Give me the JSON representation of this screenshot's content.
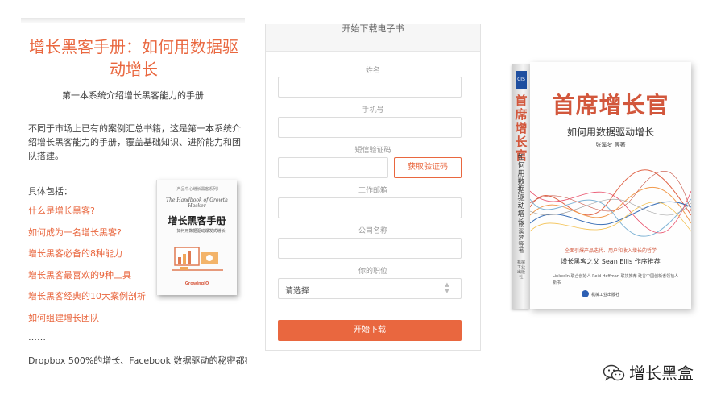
{
  "left": {
    "title": "增长黑客手册：如何用数据驱动增长",
    "subtitle": "第一本系统介绍增长黑客能力的手册",
    "intro": "不同于市场上已有的案例汇总书籍，这是第一本系统介绍增长黑客能力的手册，覆盖基础知识、进阶能力和团队搭建。",
    "includes_label": "具体包括：",
    "topics": [
      "什么是增长黑客?",
      "如何成为一名增长黑客?",
      "增长黑客必备的8种能力",
      "增长黑客最喜欢的9种工具",
      "增长黑客经典的10大案例剖析",
      "如何组建增长团队"
    ],
    "ellipsis": "……",
    "closing": "Dropbox 500%的增长、Facebook 数据驱动的秘密都在",
    "small_book": {
      "top_text": "（产品中心增长黑客系列）",
      "english_title": "The Handbook of Growth Hacker",
      "title": "增长黑客手册",
      "subtitle": "——如何用数据驱动爆发式增长",
      "logo": "GrowingIO"
    }
  },
  "form": {
    "title": "开始下载电子书",
    "fields": [
      {
        "label": "姓名"
      },
      {
        "label": "手机号"
      },
      {
        "label": "短信验证码"
      },
      {
        "label": "工作邮箱"
      },
      {
        "label": "公司名称"
      },
      {
        "label": "你的职位"
      }
    ],
    "code_button": "获取验证码",
    "select_value": "请选择",
    "submit": "开始下载"
  },
  "big_book": {
    "spine_badge": "CIS",
    "spine_title": "首席增长官",
    "spine_subtitle": "如何用数据驱动增长",
    "spine_author": "张溪梦 等著",
    "spine_publisher": "机械工业出版社",
    "title": "首席增长官",
    "subtitle": "如何用数据驱动增长",
    "author": "张溪梦  等著",
    "tagline": "全面引爆产品迭代、用户和收入增长的哲学",
    "recommend": "增长黑客之父  Sean Ellis  作序推荐",
    "recommend2": "LinkedIn 联合创始人 Reid Hoffman 联袂推荐 硅谷中国创新者领袖人 新书",
    "publisher": "机械工业出版社"
  },
  "watermark": {
    "text": "增长黑盒",
    "icon": "wechat-icon"
  },
  "colors": {
    "accent": "#e9673f",
    "book_red": "#d2573c"
  }
}
